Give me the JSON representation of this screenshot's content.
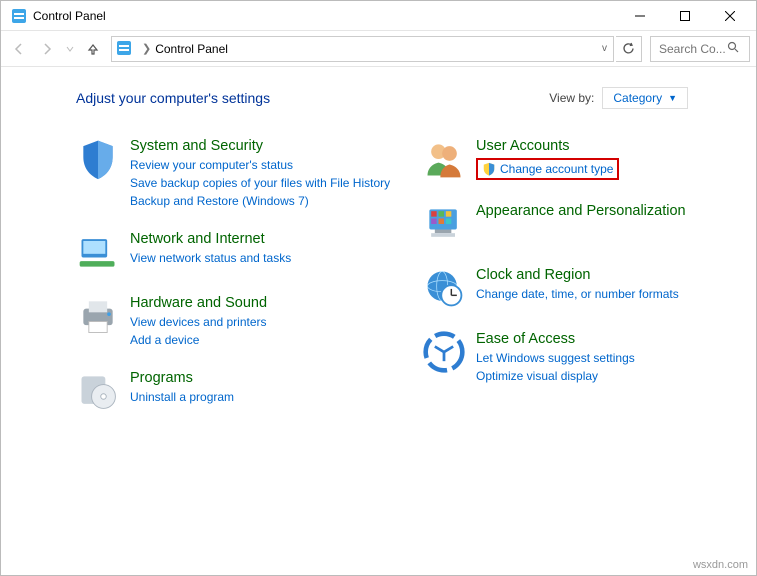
{
  "title": "Control Panel",
  "address_path": "Control Panel",
  "search_placeholder": "Search Co...",
  "heading": "Adjust your computer's settings",
  "viewby_label": "View by:",
  "viewby_value": "Category",
  "left_categories": [
    {
      "title": "System and Security",
      "links": [
        "Review your computer's status",
        "Save backup copies of your files with File History",
        "Backup and Restore (Windows 7)"
      ]
    },
    {
      "title": "Network and Internet",
      "links": [
        "View network status and tasks"
      ]
    },
    {
      "title": "Hardware and Sound",
      "links": [
        "View devices and printers",
        "Add a device"
      ]
    },
    {
      "title": "Programs",
      "links": [
        "Uninstall a program"
      ]
    }
  ],
  "right_categories": [
    {
      "title": "User Accounts",
      "highlighted_link": "Change account type",
      "shield": true
    },
    {
      "title": "Appearance and Personalization",
      "links": []
    },
    {
      "title": "Clock and Region",
      "links": [
        "Change date, time, or number formats"
      ]
    },
    {
      "title": "Ease of Access",
      "links": [
        "Let Windows suggest settings",
        "Optimize visual display"
      ]
    }
  ],
  "watermark": "wsxdn.com"
}
